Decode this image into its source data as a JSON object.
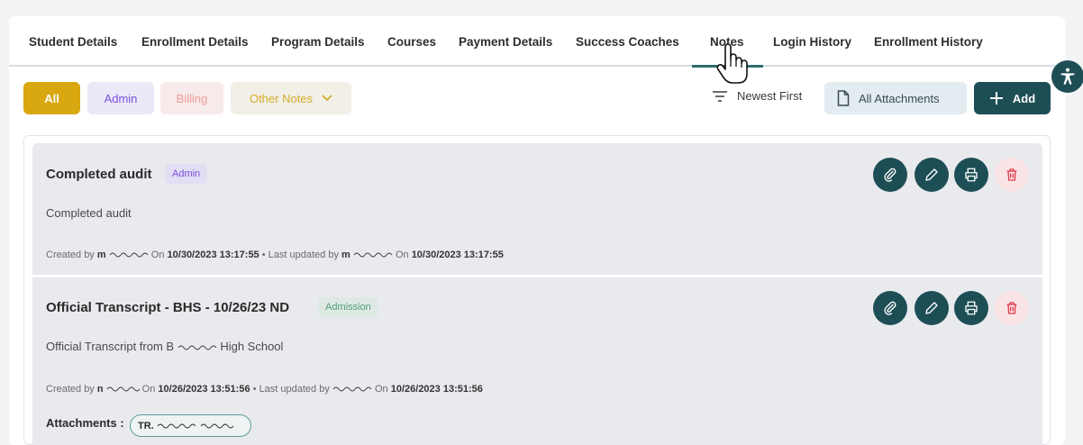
{
  "tabs": [
    "Student Details",
    "Enrollment Details",
    "Program Details",
    "Courses",
    "Payment Details",
    "Success Coaches",
    "Notes",
    "Login History",
    "Enrollment History"
  ],
  "active_tab": "Notes",
  "filters": {
    "all": "All",
    "admin": "Admin",
    "billing": "Billing",
    "other": "Other Notes"
  },
  "sort_label": "Newest First",
  "attachments_button": "All Attachments",
  "add_button": "Add",
  "notes": [
    {
      "title": "Completed audit",
      "badge": "Admin",
      "body": "Completed audit",
      "created_prefix": "Created by",
      "created_user": "m",
      "on1": "On",
      "created_date": "10/30/2023 13:17:55",
      "updated_prefix": "Last updated by",
      "updated_user": "m",
      "on2": "On",
      "updated_date": "10/30/2023 13:17:55"
    },
    {
      "title": "Official Transcript - BHS - 10/26/23 ND",
      "badge": "Admission",
      "body_start": "Official Transcript from B",
      "body_end": "High School",
      "created_prefix": "Created by",
      "created_user": "n",
      "on1": "On",
      "created_date": "10/26/2023 13:51:56",
      "updated_prefix": "Last updated by",
      "on2": "On",
      "updated_date": "10/26/2023 13:51:56",
      "attachments_label": "Attachments :",
      "attachment_chip_prefix": "TR."
    }
  ],
  "icons": [
    "paperclip-icon",
    "pencil-icon",
    "printer-icon",
    "trash-icon",
    "accessibility-icon",
    "sort-icon",
    "document-icon",
    "plus-icon",
    "chevron-down-icon",
    "hand-cursor-icon"
  ],
  "colors": {
    "primary": "#1d4e55",
    "all_filter": "#d9a70f",
    "admin": "#7a4fe0",
    "billing": "#ee9c9c",
    "other": "#d5ad2a",
    "delete": "#e0394a"
  }
}
